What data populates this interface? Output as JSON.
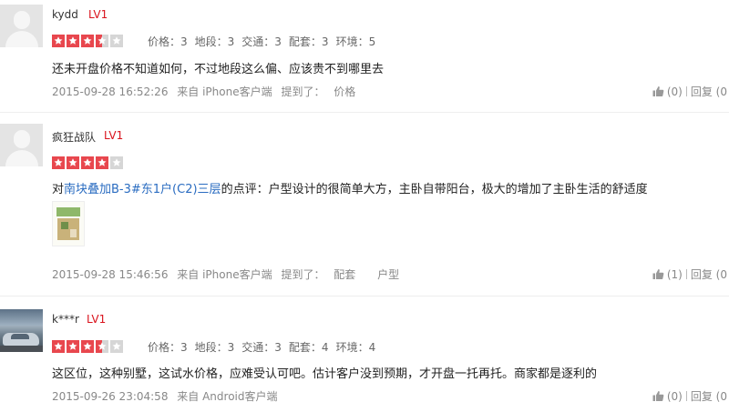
{
  "reviews": [
    {
      "username": "kydd",
      "level": "LV1",
      "stars": 3.5,
      "ratings": [
        "价格：3",
        "地段：3",
        "交通：3",
        "配套：3",
        "环境：5"
      ],
      "content_prefix": "还未开盘价格不知道如何，不过地段这么偏、应该贵不到哪里去",
      "content_link": "",
      "content_suffix": "",
      "date": "2015-09-28 16:52:26",
      "source": "来自 iPhone客户端",
      "mentioned_label": "提到了：",
      "mentioned": [
        "价格"
      ],
      "like_count": "(0)",
      "reply_label": "回复 (0"
    },
    {
      "username": "疯狂战队",
      "level": "LV1",
      "stars": 4,
      "ratings": [],
      "content_prefix": "对",
      "content_link": "南块叠加B-3#东1户(C2)三层",
      "content_suffix": "的点评：户型设计的很简单大方，主卧自带阳台，极大的增加了主卧生活的舒适度",
      "date": "2015-09-28 15:46:56",
      "source": "来自 iPhone客户端",
      "mentioned_label": "提到了：",
      "mentioned": [
        "配套",
        "户型"
      ],
      "like_count": "(1)",
      "reply_label": "回复 (0"
    },
    {
      "username": "k***r",
      "level": "LV1",
      "stars": 3.5,
      "ratings": [
        "价格：3",
        "地段：3",
        "交通：3",
        "配套：4",
        "环境：4"
      ],
      "content_prefix": "这区位，这种别墅，这试水价格，应难受认可吧。估计客户没到预期，才开盘一托再托。商家都是逐利的",
      "content_link": "",
      "content_suffix": "",
      "date": "2015-09-26 23:04:58",
      "source": "来自 Android客户端",
      "mentioned_label": "",
      "mentioned": [],
      "like_count": "(0)",
      "reply_label": "回复 (0"
    }
  ],
  "colors": {
    "star_on": "#e8474e",
    "star_off": "#d6d6d6",
    "level": "#d9121c",
    "link": "#2a6cc1"
  },
  "icons": [
    "user-avatar-icon",
    "star-icon",
    "thumbs-up-icon"
  ]
}
